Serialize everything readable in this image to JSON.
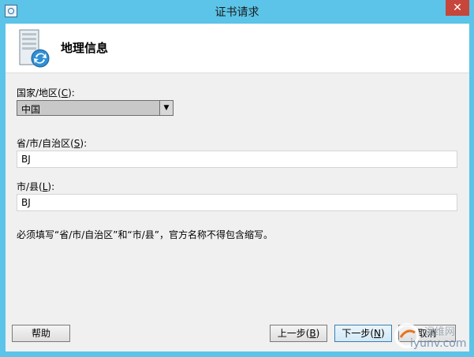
{
  "window": {
    "title": "证书请求",
    "close_glyph": "✕"
  },
  "header": {
    "title": "地理信息",
    "icon": "server-certificate-icon"
  },
  "country": {
    "label_prefix": "国家/地区(",
    "label_key": "C",
    "label_suffix": "):",
    "selected": "中国",
    "arrow": "▼"
  },
  "province": {
    "label_prefix": "省/市/自治区(",
    "label_key": "S",
    "label_suffix": "):",
    "value": "BJ"
  },
  "city": {
    "label_prefix": "市/县(",
    "label_key": "L",
    "label_suffix": "):",
    "value": "BJ"
  },
  "note": "必须填写“省/市/自治区”和“市/县”，官方名称不得包含缩写。",
  "buttons": {
    "help": "帮助",
    "back_prefix": "上一步(",
    "back_key": "B",
    "back_suffix": ")",
    "next_prefix": "下一步(",
    "next_key": "N",
    "next_suffix": ")",
    "cancel": "取消"
  },
  "watermark": {
    "line1": "运维网",
    "line2": "iyunv.com"
  }
}
